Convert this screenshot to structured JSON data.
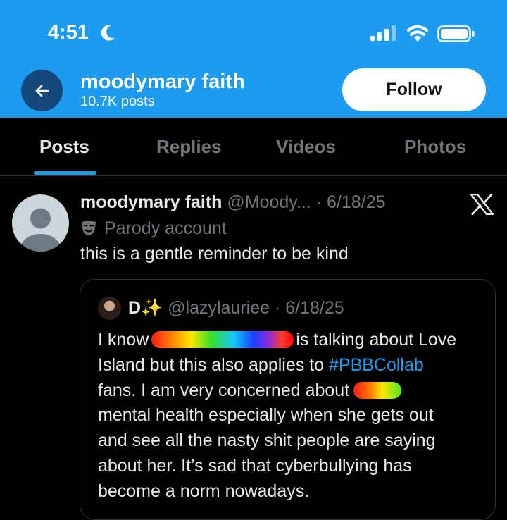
{
  "status_bar": {
    "time": "4:51"
  },
  "header": {
    "name": "moodymary faith",
    "posts_count": "10.7K posts",
    "follow_label": "Follow"
  },
  "tabs": [
    {
      "label": "Posts"
    },
    {
      "label": "Replies"
    },
    {
      "label": "Videos"
    },
    {
      "label": "Photos"
    }
  ],
  "post": {
    "author_name": "moodymary faith",
    "handle_date": "@Moody... · 6/18/25",
    "parody_label": "Parody account",
    "text": "this is a gentle reminder to be kind"
  },
  "quote": {
    "author_name": "D✨",
    "handle_date": "@lazylauriee · 6/18/25",
    "line1_a": "I know",
    "line1_b": "is talking about Love",
    "line2_a": "Island but this also applies to ",
    "line2_hashtag": "#PBBCollab",
    "line3_a": "fans. I am very concerned about",
    "line4": "mental health especially when she gets out",
    "line5": "and see all the nasty shit people are saying",
    "line6": "about her. It’s sad that cyberbullying has",
    "line7": "become a norm nowadays."
  },
  "colors": {
    "accent": "#1d9bf0",
    "background": "#000000",
    "secondary_text": "#71767b"
  }
}
